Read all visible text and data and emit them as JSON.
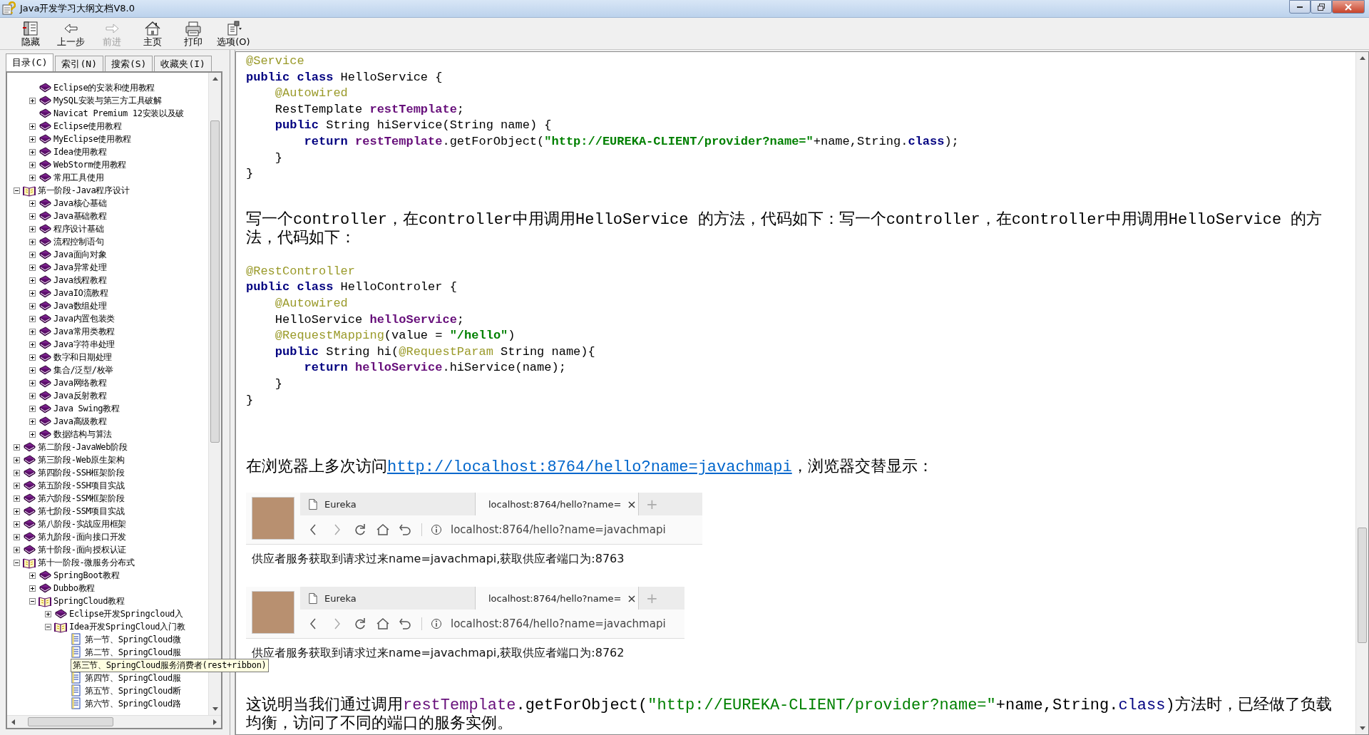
{
  "window": {
    "title": "Java开发学习大纲文档V8.0"
  },
  "toolbar": [
    {
      "label": "隐藏",
      "kind": "hide",
      "disabled": false
    },
    {
      "label": "上一步",
      "kind": "back",
      "disabled": false
    },
    {
      "label": "前进",
      "kind": "forward",
      "disabled": true
    },
    {
      "label": "主页",
      "kind": "home",
      "disabled": false
    },
    {
      "label": "打印",
      "kind": "print",
      "disabled": false
    },
    {
      "label": "选项(O)",
      "kind": "options",
      "disabled": false
    }
  ],
  "nav_tabs": [
    {
      "label": "目录(C)",
      "selected": true
    },
    {
      "label": "索引(N)",
      "selected": false
    },
    {
      "label": "搜索(S)",
      "selected": false
    },
    {
      "label": "收藏夹(I)",
      "selected": false
    }
  ],
  "tree": {
    "continued_children": [
      {
        "label": "Eclipse的安装和使用教程",
        "kind": "book"
      },
      {
        "label": "MySQL安装与第三方工具破解",
        "kind": "book",
        "expanded": false
      },
      {
        "label": "Navicat Premium 12安装以及破",
        "kind": "book"
      },
      {
        "label": "Eclipse使用教程",
        "kind": "book",
        "expanded": false
      },
      {
        "label": "MyEclipse使用教程",
        "kind": "book",
        "expanded": false
      },
      {
        "label": "Idea使用教程",
        "kind": "book",
        "expanded": false
      },
      {
        "label": "WebStorm使用教程",
        "kind": "book",
        "expanded": false
      },
      {
        "label": "常用工具使用",
        "kind": "book",
        "expanded": false
      }
    ],
    "items": [
      {
        "label": "第一阶段-Java程序设计",
        "kind": "book",
        "expanded": true,
        "children": [
          {
            "label": "Java核心基础",
            "kind": "book",
            "expanded": false
          },
          {
            "label": "Java基础教程",
            "kind": "book",
            "expanded": false
          },
          {
            "label": "程序设计基础",
            "kind": "book",
            "expanded": false
          },
          {
            "label": "流程控制语句",
            "kind": "book",
            "expanded": false
          },
          {
            "label": "Java面向对象",
            "kind": "book",
            "expanded": false
          },
          {
            "label": "Java异常处理",
            "kind": "book",
            "expanded": false
          },
          {
            "label": "Java线程教程",
            "kind": "book",
            "expanded": false
          },
          {
            "label": "JavaIO流教程",
            "kind": "book",
            "expanded": false
          },
          {
            "label": "Java数组处理",
            "kind": "book",
            "expanded": false
          },
          {
            "label": "Java内置包装类",
            "kind": "book",
            "expanded": false
          },
          {
            "label": "Java常用类教程",
            "kind": "book",
            "expanded": false
          },
          {
            "label": "Java字符串处理",
            "kind": "book",
            "expanded": false
          },
          {
            "label": "数字和日期处理",
            "kind": "book",
            "expanded": false
          },
          {
            "label": "集合/泛型/枚举",
            "kind": "book",
            "expanded": false
          },
          {
            "label": "Java网络教程",
            "kind": "book",
            "expanded": false
          },
          {
            "label": "Java反射教程",
            "kind": "book",
            "expanded": false
          },
          {
            "label": "Java Swing教程",
            "kind": "book",
            "expanded": false
          },
          {
            "label": "Java高级教程",
            "kind": "book",
            "expanded": false
          },
          {
            "label": "数据结构与算法",
            "kind": "book",
            "expanded": false
          }
        ]
      },
      {
        "label": "第二阶段-JavaWeb阶段",
        "kind": "book",
        "expanded": false
      },
      {
        "label": "第三阶段-Web原生架构",
        "kind": "book",
        "expanded": false
      },
      {
        "label": "第四阶段-SSH框架阶段",
        "kind": "book",
        "expanded": false
      },
      {
        "label": "第五阶段-SSH项目实战",
        "kind": "book",
        "expanded": false
      },
      {
        "label": "第六阶段-SSM框架阶段",
        "kind": "book",
        "expanded": false
      },
      {
        "label": "第七阶段-SSM项目实战",
        "kind": "book",
        "expanded": false
      },
      {
        "label": "第八阶段-实战应用框架",
        "kind": "book",
        "expanded": false
      },
      {
        "label": "第九阶段-面向接口开发",
        "kind": "book",
        "expanded": false
      },
      {
        "label": "第十阶段-面向授权认证",
        "kind": "book",
        "expanded": false
      },
      {
        "label": "第十一阶段-微服务分布式",
        "kind": "book",
        "expanded": true,
        "children": [
          {
            "label": "SpringBoot教程",
            "kind": "book",
            "expanded": false
          },
          {
            "label": "Dubbo教程",
            "kind": "book",
            "expanded": false
          },
          {
            "label": "SpringCloud教程",
            "kind": "book",
            "expanded": true,
            "children": [
              {
                "label": "Eclipse开发Springcloud入",
                "kind": "book",
                "expanded": false
              },
              {
                "label": "Idea开发SpringCloud入门教",
                "kind": "book",
                "expanded": true,
                "children": [
                  {
                    "label": "第一节、SpringCloud微",
                    "kind": "page"
                  },
                  {
                    "label": "第二节、SpringCloud服",
                    "kind": "page"
                  },
                  {
                    "label": "第三节、SpringCloud服务消费者(rest+ribbon)",
                    "kind": "page",
                    "hovered": true
                  },
                  {
                    "label": "第四节、SpringCloud服",
                    "kind": "page"
                  },
                  {
                    "label": "第五节、SpringCloud断",
                    "kind": "page"
                  },
                  {
                    "label": "第六节、SpringCloud路",
                    "kind": "page"
                  }
                ]
              }
            ]
          }
        ]
      }
    ]
  },
  "content": [
    {
      "kind": "code",
      "lines": [
        [
          {
            "text": "@Service",
            "kind": "annotation"
          }
        ],
        [
          {
            "text": "public class",
            "kind": "keyword"
          },
          {
            "text": " HelloService {",
            "kind": "plain"
          }
        ],
        [
          {
            "text": "    @Autowired",
            "kind": "annotation"
          }
        ],
        [
          {
            "text": "    RestTemplate ",
            "kind": "plain"
          },
          {
            "text": "restTemplate",
            "kind": "field"
          },
          {
            "text": ";",
            "kind": "plain"
          }
        ],
        [
          {
            "text": "    public",
            "kind": "keyword"
          },
          {
            "text": " String hiService(String name) {",
            "kind": "plain"
          }
        ],
        [
          {
            "text": "        return ",
            "kind": "keyword"
          },
          {
            "text": "restTemplate",
            "kind": "field"
          },
          {
            "text": ".getForObject(",
            "kind": "plain"
          },
          {
            "text": "\"http://EUREKA-CLIENT/provider?name=\"",
            "kind": "string"
          },
          {
            "text": "+name,String.",
            "kind": "plain"
          },
          {
            "text": "class",
            "kind": "keyword"
          },
          {
            "text": ");",
            "kind": "plain"
          }
        ],
        [
          {
            "text": "    }",
            "kind": "plain"
          }
        ],
        [
          {
            "text": "}",
            "kind": "plain"
          }
        ]
      ]
    },
    {
      "kind": "paragraph",
      "text": "写一个controller，在controller中用调用HelloService 的方法，代码如下：写一个controller，在controller中用调用HelloService 的方法，代码如下："
    },
    {
      "kind": "code",
      "lines": [
        [
          {
            "text": "@RestController",
            "kind": "annotation"
          }
        ],
        [
          {
            "text": "public class",
            "kind": "keyword"
          },
          {
            "text": " HelloControler {",
            "kind": "plain"
          }
        ],
        [
          {
            "text": "    @Autowired",
            "kind": "annotation"
          }
        ],
        [
          {
            "text": "    HelloService ",
            "kind": "plain"
          },
          {
            "text": "helloService",
            "kind": "field"
          },
          {
            "text": ";",
            "kind": "plain"
          }
        ],
        [
          {
            "text": "    @RequestMapping",
            "kind": "annotation"
          },
          {
            "text": "(value = ",
            "kind": "plain"
          },
          {
            "text": "\"/hello\"",
            "kind": "string"
          },
          {
            "text": ")",
            "kind": "plain"
          }
        ],
        [
          {
            "text": "    public",
            "kind": "keyword"
          },
          {
            "text": " String hi(",
            "kind": "plain"
          },
          {
            "text": "@RequestParam",
            "kind": "annotation"
          },
          {
            "text": " String name){",
            "kind": "plain"
          }
        ],
        [
          {
            "text": "        return ",
            "kind": "keyword"
          },
          {
            "text": "helloService",
            "kind": "field"
          },
          {
            "text": ".hiService(name);",
            "kind": "plain"
          }
        ],
        [
          {
            "text": "    }",
            "kind": "plain"
          }
        ],
        [
          {
            "text": "}",
            "kind": "plain"
          }
        ]
      ]
    },
    {
      "kind": "link_paragraph",
      "before": "在浏览器上多次访问",
      "link": "http://localhost:8764/hello?name=javachmapi",
      "after": "，浏览器交替显示："
    },
    {
      "kind": "browser",
      "tabs": [
        {
          "label": "Eureka",
          "selected": false
        },
        {
          "label": "localhost:8764/hello?name=",
          "selected": true,
          "close": "×"
        }
      ],
      "new_tab": "+",
      "address": "localhost:8764/hello?name=javachmapi",
      "response": "供应者服务获取到请求过来name=javachmapi,获取供应者端口为:8763"
    },
    {
      "kind": "browser",
      "tabs": [
        {
          "label": "Eureka",
          "selected": false
        },
        {
          "label": "localhost:8764/hello?name=",
          "selected": true,
          "close": "×"
        }
      ],
      "new_tab": "+",
      "address": "localhost:8764/hello?name=javachmapi",
      "response": "供应者服务获取到请求过来name=javachmapi,获取供应者端口为:8762"
    },
    {
      "kind": "mixed_paragraph",
      "tokens": [
        {
          "text": "这说明当我们通过调用",
          "kind": "plain"
        },
        {
          "text": "restTemplate",
          "kind": "field"
        },
        {
          "text": ".getForObject(",
          "kind": "mono"
        },
        {
          "text": "\"http://EUREKA-CLIENT/provider?name=\"",
          "kind": "string"
        },
        {
          "text": "+name,String.",
          "kind": "mono"
        },
        {
          "text": "class",
          "kind": "keyword"
        },
        {
          "text": ")方法时，已经做了负载均衡，访问了不同的端口的服务实例。",
          "kind": "plain"
        }
      ]
    }
  ]
}
